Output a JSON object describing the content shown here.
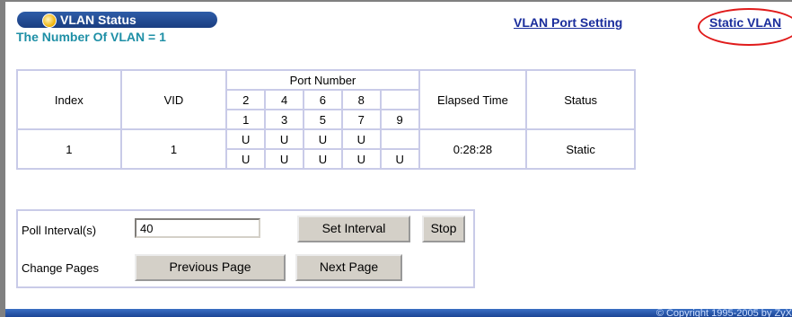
{
  "header": {
    "title": "VLAN Status",
    "vlan_count": "The Number Of VLAN = 1",
    "links": {
      "port_setting": "VLAN Port Setting",
      "static_vlan": "Static VLAN"
    }
  },
  "table": {
    "headers": {
      "index": "Index",
      "vid": "VID",
      "port_number": "Port Number",
      "elapsed": "Elapsed Time",
      "status": "Status"
    },
    "port_row_top": [
      "2",
      "4",
      "6",
      "8",
      ""
    ],
    "port_row_bottom": [
      "1",
      "3",
      "5",
      "7",
      "9"
    ],
    "rows": [
      {
        "index": "1",
        "vid": "1",
        "ports_top": [
          "U",
          "U",
          "U",
          "U",
          ""
        ],
        "ports_bottom": [
          "U",
          "U",
          "U",
          "U",
          "U"
        ],
        "elapsed": "0:28:28",
        "status": "Static"
      }
    ]
  },
  "controls": {
    "poll_label": "Poll Interval(s)",
    "poll_value": "40",
    "set_interval": "Set Interval",
    "stop": "Stop",
    "change_pages_label": "Change Pages",
    "previous_page": "Previous Page",
    "next_page": "Next Page"
  },
  "footer": {
    "copyright": "© Copyright 1995-2005 by ZyX"
  },
  "colors": {
    "accent": "#1a2d9c",
    "count_text": "#1e8fa6",
    "border": "#c9cbe8",
    "highlight": "#e01b1b"
  }
}
